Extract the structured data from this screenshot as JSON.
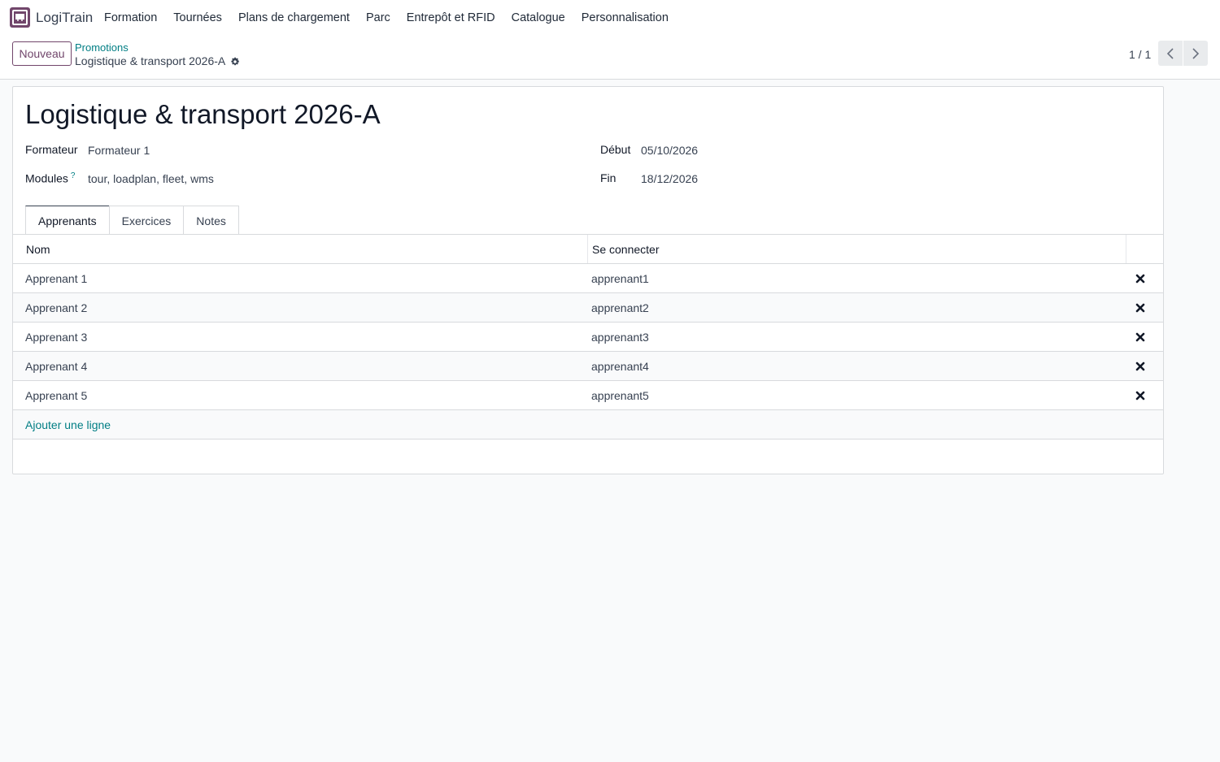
{
  "app": {
    "name": "LogiTrain",
    "brand_color": "#71466b"
  },
  "menu": {
    "items": [
      {
        "label": "Formation"
      },
      {
        "label": "Tournées"
      },
      {
        "label": "Plans de chargement"
      },
      {
        "label": "Parc"
      },
      {
        "label": "Entrepôt et RFID"
      },
      {
        "label": "Catalogue"
      },
      {
        "label": "Personnalisation"
      }
    ]
  },
  "control": {
    "new_label": "Nouveau",
    "breadcrumb_parent": "Promotions",
    "breadcrumb_current": "Logistique & transport 2026-A",
    "pager": "1 / 1"
  },
  "record": {
    "title": "Logistique & transport 2026-A",
    "fields": {
      "formateur_label": "Formateur",
      "formateur_value": "Formateur 1",
      "modules_label": "Modules",
      "modules_help": "?",
      "modules_value": "tour, loadplan, fleet, wms",
      "debut_label": "Début",
      "debut_value": "05/10/2026",
      "fin_label": "Fin",
      "fin_value": "18/12/2026"
    }
  },
  "tabs": [
    {
      "label": "Apprenants",
      "active": true
    },
    {
      "label": "Exercices",
      "active": false
    },
    {
      "label": "Notes",
      "active": false
    }
  ],
  "table": {
    "columns": [
      "Nom",
      "Se connecter"
    ],
    "rows": [
      {
        "nom": "Apprenant 1",
        "login": "apprenant1"
      },
      {
        "nom": "Apprenant 2",
        "login": "apprenant2"
      },
      {
        "nom": "Apprenant 3",
        "login": "apprenant3"
      },
      {
        "nom": "Apprenant 4",
        "login": "apprenant4"
      },
      {
        "nom": "Apprenant 5",
        "login": "apprenant5"
      }
    ],
    "add_line_label": "Ajouter une ligne",
    "delete_icon": "close-icon"
  },
  "colors": {
    "link": "#017e84",
    "text": "#374151",
    "title": "#111827"
  }
}
